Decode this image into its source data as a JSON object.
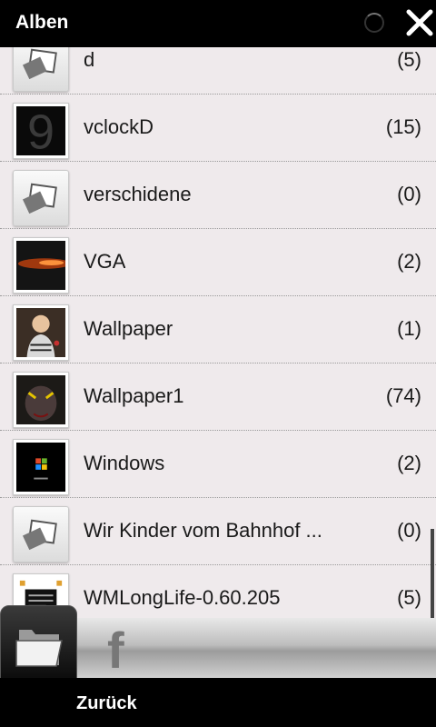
{
  "titlebar": {
    "title": "Alben",
    "loading_icon": "spinner-icon",
    "close_icon": "close-icon"
  },
  "albums": [
    {
      "name": "d",
      "count": "(5)",
      "thumb": "generic"
    },
    {
      "name": "vclockD",
      "count": "(15)",
      "thumb": "vclock"
    },
    {
      "name": "verschidene",
      "count": "(0)",
      "thumb": "generic"
    },
    {
      "name": "VGA",
      "count": "(2)",
      "thumb": "vga"
    },
    {
      "name": "Wallpaper",
      "count": "(1)",
      "thumb": "person"
    },
    {
      "name": "Wallpaper1",
      "count": "(74)",
      "thumb": "dark"
    },
    {
      "name": "Windows",
      "count": "(2)",
      "thumb": "windows"
    },
    {
      "name": "Wir Kinder vom Bahnhof ...",
      "count": "(0)",
      "thumb": "generic"
    },
    {
      "name": "WMLongLife-0.60.205",
      "count": "(5)",
      "thumb": "wmlonglife"
    }
  ],
  "tabs": [
    {
      "icon": "folder-icon",
      "selected": true
    },
    {
      "icon": "facebook-icon",
      "label": "f",
      "selected": false
    }
  ],
  "softkeys": {
    "left": "Zurück"
  }
}
